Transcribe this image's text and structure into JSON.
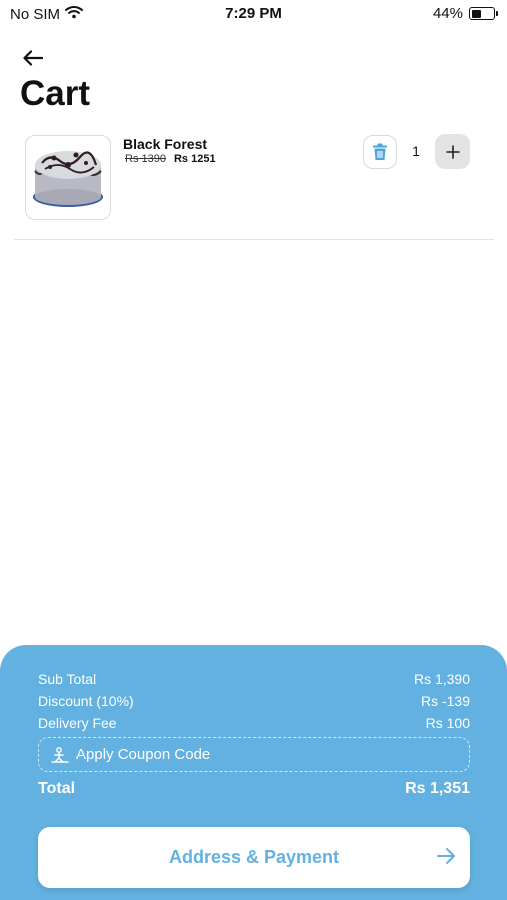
{
  "status_bar": {
    "carrier": "No SIM",
    "time": "7:29 PM",
    "battery": "44%",
    "battery_level": 0.44
  },
  "header": {
    "title": "Cart"
  },
  "cart": {
    "items": [
      {
        "name": "Black Forest",
        "old_price": "Rs 1390",
        "new_price": "Rs 1251",
        "quantity": "1",
        "image_icon": "cake-image"
      }
    ]
  },
  "summary": {
    "subtotal_label": "Sub Total",
    "subtotal_value": "Rs 1,390",
    "discount_label": "Discount (10%)",
    "discount_value": "Rs -139",
    "delivery_label": "Delivery Fee",
    "delivery_value": "Rs 100",
    "coupon_label": "Apply Coupon Code",
    "total_label": "Total",
    "total_value": "Rs 1,351"
  },
  "cta": {
    "label": "Address & Payment"
  },
  "colors": {
    "accent": "#62b1e0",
    "delete_icon": "#4ea3db",
    "plus_button_bg": "#e3e3e3"
  },
  "icons": [
    "wifi-icon",
    "battery-icon",
    "back-arrow-icon",
    "trash-icon",
    "plus-icon",
    "coupon-icon",
    "arrow-right-icon"
  ]
}
